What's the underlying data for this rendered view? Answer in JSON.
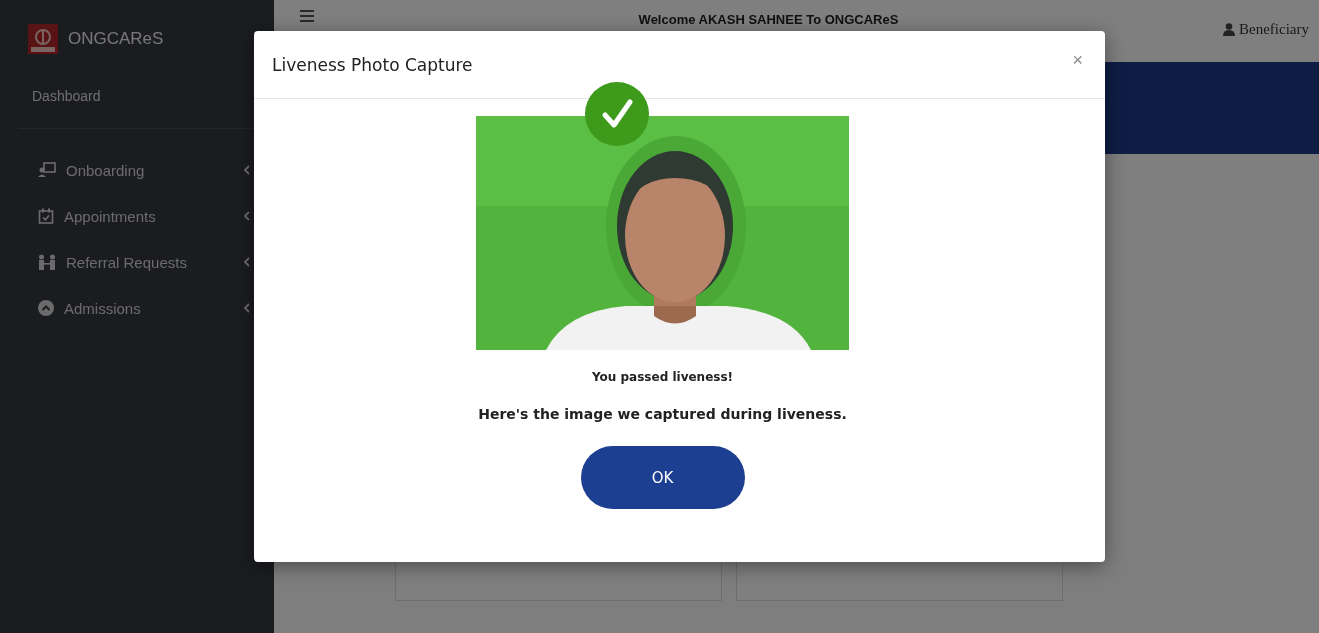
{
  "sidebar": {
    "brand": "ONGCAReS",
    "heading": "Dashboard",
    "items": [
      {
        "label": "Onboarding"
      },
      {
        "label": "Appointments"
      },
      {
        "label": "Referral Requests"
      },
      {
        "label": "Admissions"
      }
    ]
  },
  "header": {
    "welcome": "Welcome AKASH SAHNEE To ONGCAReS",
    "user": "Beneficiary"
  },
  "modal": {
    "title": "Liveness Photo Capture",
    "close": "×",
    "status": "You passed liveness!",
    "caption": "Here's the image we captured during liveness.",
    "ok_button": "OK"
  }
}
